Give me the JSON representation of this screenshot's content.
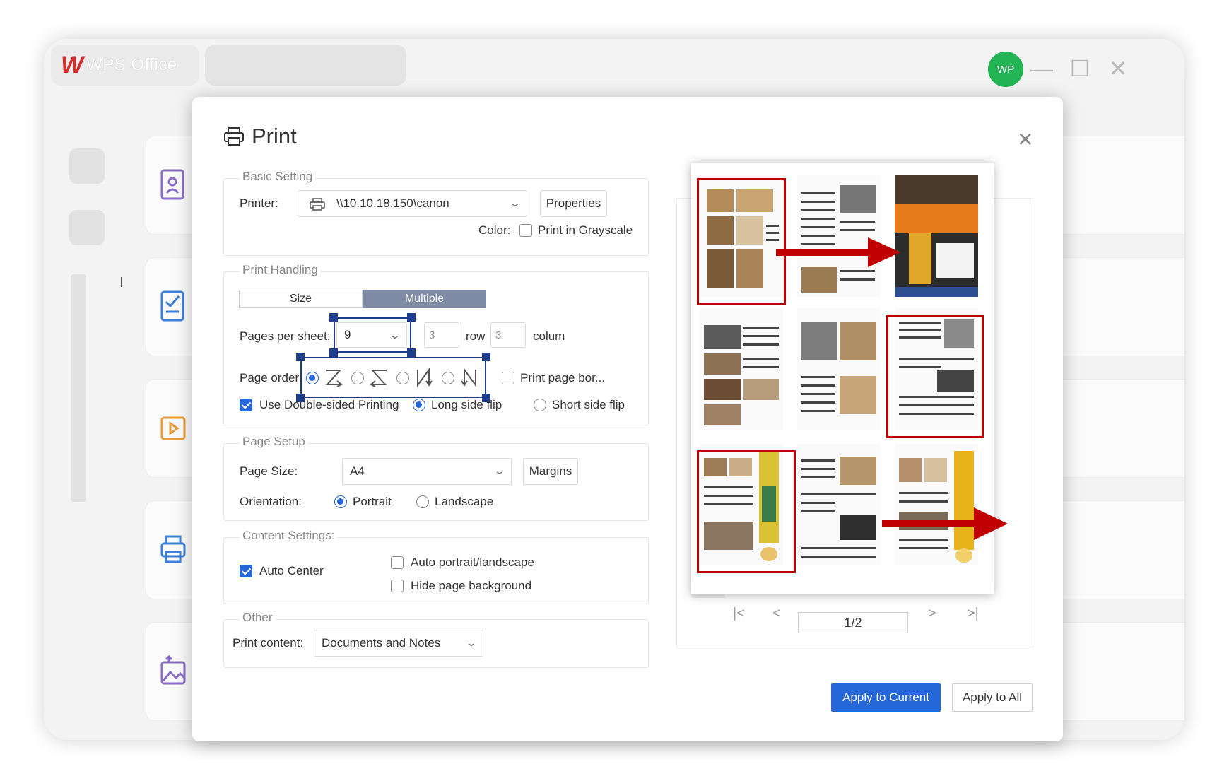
{
  "app": {
    "brand_logo": "W",
    "brand_name": "WPS Office",
    "avatar_initials": "WP",
    "minimize": "—",
    "maximize": "☐",
    "close": "✕"
  },
  "dialog": {
    "title": "Print",
    "close": "✕",
    "basic_setting": {
      "legend": "Basic Setting",
      "printer_label": "Printer:",
      "printer_value": "\\\\10.10.18.150\\canon",
      "properties_button": "Properties",
      "color_label": "Color:",
      "grayscale_label": "Print in Grayscale"
    },
    "print_handling": {
      "legend": "Print Handling",
      "tab_size": "Size",
      "tab_multiple": "Multiple",
      "pages_per_sheet_label": "Pages per sheet:",
      "pages_per_sheet_value": "9",
      "rows_value": "3",
      "rows_label": "row",
      "cols_value": "3",
      "cols_label": "colum",
      "page_order_label": "Page order:",
      "print_border_label": "Print page bor...",
      "double_sided_label": "Use Double-sided Printing",
      "long_side_label": "Long side flip",
      "short_side_label": "Short side flip"
    },
    "page_setup": {
      "legend": "Page Setup",
      "page_size_label": "Page Size:",
      "page_size_value": "A4",
      "margins_button": "Margins",
      "orientation_label": "Orientation:",
      "portrait_label": "Portrait",
      "landscape_label": "Landscape"
    },
    "content_settings": {
      "legend": "Content Settings:",
      "auto_center_label": "Auto Center",
      "auto_orient_label": "Auto portrait/landscape",
      "hide_bg_label": "Hide page background"
    },
    "other": {
      "legend": "Other",
      "print_content_label": "Print content:",
      "print_content_value": "Documents and Notes"
    },
    "preview": {
      "page_indicator": "1/2",
      "first": "|<",
      "prev": "<",
      "next": ">",
      "last": ">|"
    },
    "apply_current": "Apply to Current",
    "apply_all": "Apply to All"
  },
  "colors": {
    "accent": "#2566d8",
    "annotation_red": "#c00000",
    "annotation_blue": "#1e3d8a",
    "avatar": "#22b455",
    "tab_active": "#7f8aa5"
  },
  "icons": [
    "printer-icon",
    "chevron-down-icon",
    "close-icon",
    "first-page-icon",
    "prev-page-icon",
    "next-page-icon",
    "last-page-icon"
  ]
}
